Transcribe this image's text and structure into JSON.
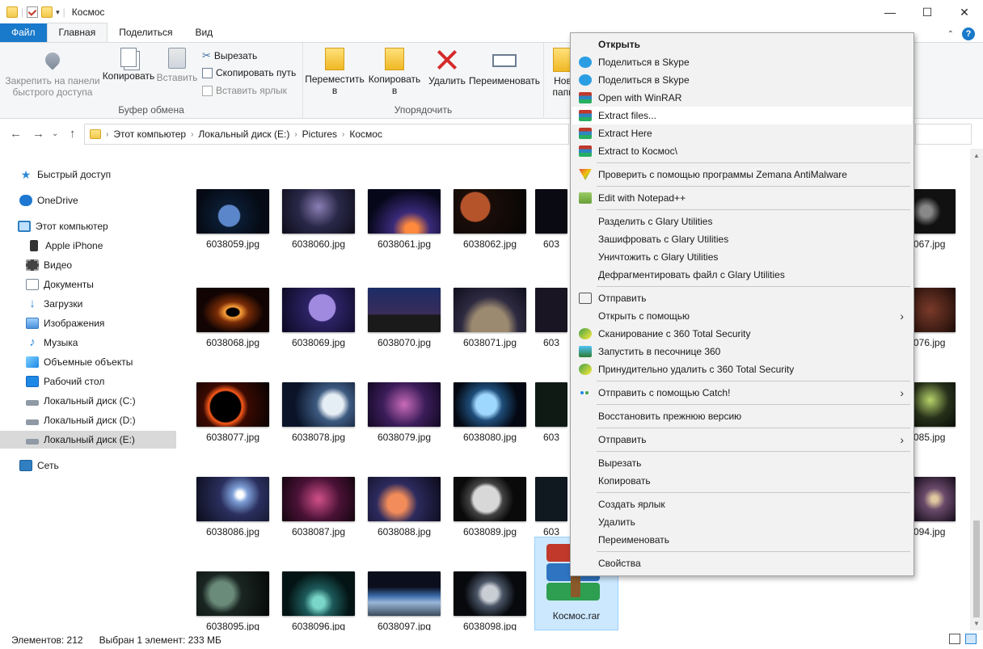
{
  "window": {
    "title": "Космос",
    "minimize": "—",
    "maximize": "☐",
    "close": "✕"
  },
  "tabs": [
    "Файл",
    "Главная",
    "Поделиться",
    "Вид"
  ],
  "ribbon": {
    "pin": "Закрепить на панели быстрого доступа",
    "pin_l1": "Закрепить на панели",
    "pin_l2": "быстрого доступа",
    "copy": "Копировать",
    "paste": "Вставить",
    "cut": "Вырезать",
    "copy_path": "Скопировать путь",
    "paste_shortcut": "Вставить ярлык",
    "clipboard_group": "Буфер обмена",
    "move_l1": "Переместить",
    "move_l2": "в",
    "copyto_l1": "Копировать",
    "copyto_l2": "в",
    "delete": "Удалить",
    "rename": "Переименовать",
    "organize_group": "Упорядочить",
    "new_l1": "Нов",
    "new_l2": "папк"
  },
  "address": {
    "parts": [
      "Этот компьютер",
      "Локальный диск (E:)",
      "Pictures",
      "Космос"
    ]
  },
  "nav": [
    {
      "label": "Быстрый доступ",
      "icon": "star-icon"
    },
    {
      "label": "OneDrive",
      "icon": "cloud-icon"
    },
    {
      "label": "Этот компьютер",
      "icon": "computer-icon"
    },
    {
      "label": "Apple iPhone",
      "icon": "phone-icon"
    },
    {
      "label": "Видео",
      "icon": "video-icon"
    },
    {
      "label": "Документы",
      "icon": "documents-icon"
    },
    {
      "label": "Загрузки",
      "icon": "downloads-icon"
    },
    {
      "label": "Изображения",
      "icon": "pictures-icon"
    },
    {
      "label": "Музыка",
      "icon": "music-icon"
    },
    {
      "label": "Объемные объекты",
      "icon": "3d-objects-icon"
    },
    {
      "label": "Рабочий стол",
      "icon": "desktop-icon"
    },
    {
      "label": "Локальный диск (C:)",
      "icon": "drive-icon"
    },
    {
      "label": "Локальный диск (D:)",
      "icon": "drive-icon"
    },
    {
      "label": "Локальный диск (E:)",
      "icon": "drive-icon"
    },
    {
      "label": "Сеть",
      "icon": "network-icon"
    }
  ],
  "files": [
    [
      "6038059.jpg",
      "6038060.jpg",
      "6038061.jpg",
      "6038062.jpg",
      "603",
      "067.jpg"
    ],
    [
      "6038068.jpg",
      "6038069.jpg",
      "6038070.jpg",
      "6038071.jpg",
      "603",
      "076.jpg"
    ],
    [
      "6038077.jpg",
      "6038078.jpg",
      "6038079.jpg",
      "6038080.jpg",
      "603",
      "085.jpg"
    ],
    [
      "6038086.jpg",
      "6038087.jpg",
      "6038088.jpg",
      "6038089.jpg",
      "603",
      "094.jpg"
    ],
    [
      "6038095.jpg",
      "6038096.jpg",
      "6038097.jpg",
      "6038098.jpg",
      "Космос.rar"
    ]
  ],
  "context_menu": [
    {
      "label": "Открыть",
      "bold": true,
      "icon": ""
    },
    {
      "label": "Поделиться в Skype",
      "icon": "skype-icon"
    },
    {
      "label": "Поделиться в Skype",
      "icon": "skype-icon"
    },
    {
      "label": "Open with WinRAR",
      "icon": "winrar-icon"
    },
    {
      "label": "Extract files...",
      "icon": "winrar-icon",
      "highlight": true
    },
    {
      "label": "Extract Here",
      "icon": "winrar-icon"
    },
    {
      "label": "Extract to Космос\\",
      "icon": "winrar-icon"
    },
    {
      "label": "Проверить с помощью программы Zemana AntiMalware",
      "icon": "zemana-icon"
    },
    {
      "label": "Edit with Notepad++",
      "icon": "notepadpp-icon"
    },
    {
      "label": "Разделить с Glary Utilities",
      "icon": ""
    },
    {
      "label": "Зашифровать с Glary Utilities",
      "icon": ""
    },
    {
      "label": "Уничтожить с Glary Utilities",
      "icon": ""
    },
    {
      "label": "Дефрагментировать файл с Glary Utilities",
      "icon": ""
    },
    {
      "label": "Отправить",
      "icon": "share-icon"
    },
    {
      "label": "Открыть с помощью",
      "icon": "",
      "submenu": true
    },
    {
      "label": "Сканирование с 360 Total Security",
      "icon": "360-icon"
    },
    {
      "label": "Запустить в песочнице 360",
      "icon": "sandbox-icon"
    },
    {
      "label": "Принудительно удалить с  360 Total Security",
      "icon": "360-icon"
    },
    {
      "label": "Отправить с помощью Catch!",
      "icon": "catch-icon",
      "submenu": true
    },
    {
      "label": "Восстановить прежнюю версию",
      "icon": ""
    },
    {
      "label": "Отправить",
      "icon": "",
      "submenu": true
    },
    {
      "label": "Вырезать",
      "icon": ""
    },
    {
      "label": "Копировать",
      "icon": ""
    },
    {
      "label": "Создать ярлык",
      "icon": ""
    },
    {
      "label": "Удалить",
      "icon": ""
    },
    {
      "label": "Переименовать",
      "icon": ""
    },
    {
      "label": "Свойства",
      "icon": ""
    }
  ],
  "status": {
    "count": "Элементов: 212",
    "selection": "Выбран 1 элемент: 233 МБ"
  }
}
